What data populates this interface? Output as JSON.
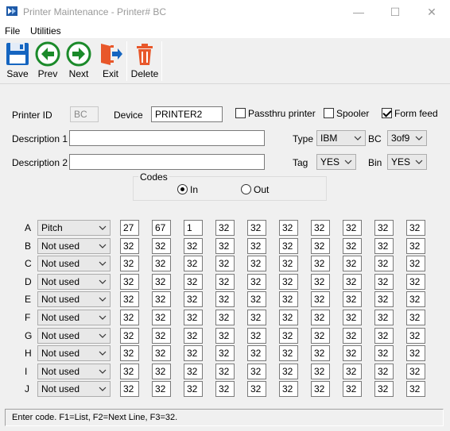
{
  "window": {
    "title": "Printer Maintenance - Printer# BC",
    "minimize": "—",
    "maximize": "☐",
    "close": "✕"
  },
  "menu": [
    "File",
    "Utilities"
  ],
  "toolbar": {
    "save": "Save",
    "prev": "Prev",
    "next": "Next",
    "exit": "Exit",
    "delete": "Delete"
  },
  "form": {
    "printer_id_label": "Printer ID",
    "printer_id_value": "BC",
    "device_label": "Device",
    "device_value": "PRINTER2",
    "passthru_label": "Passthru printer",
    "passthru_checked": false,
    "spooler_label": "Spooler",
    "spooler_checked": false,
    "formfeed_label": "Form feed",
    "formfeed_checked": true,
    "desc1_label": "Description 1",
    "desc1_value": "",
    "desc2_label": "Description 2",
    "desc2_value": "",
    "type_label": "Type",
    "type_value": "IBM",
    "bc_label": "BC",
    "bc_value": "3of9",
    "tag_label": "Tag",
    "tag_value": "YES",
    "bin_label": "Bin",
    "bin_value": "YES"
  },
  "codes": {
    "group_label": "Codes",
    "in_label": "In",
    "out_label": "Out",
    "selected": "In",
    "rows": [
      {
        "letter": "A",
        "option": "Pitch",
        "values": [
          "27",
          "67",
          "1",
          "32",
          "32",
          "32",
          "32",
          "32",
          "32",
          "32"
        ]
      },
      {
        "letter": "B",
        "option": "Not used",
        "values": [
          "32",
          "32",
          "32",
          "32",
          "32",
          "32",
          "32",
          "32",
          "32",
          "32"
        ]
      },
      {
        "letter": "C",
        "option": "Not used",
        "values": [
          "32",
          "32",
          "32",
          "32",
          "32",
          "32",
          "32",
          "32",
          "32",
          "32"
        ]
      },
      {
        "letter": "D",
        "option": "Not used",
        "values": [
          "32",
          "32",
          "32",
          "32",
          "32",
          "32",
          "32",
          "32",
          "32",
          "32"
        ]
      },
      {
        "letter": "E",
        "option": "Not used",
        "values": [
          "32",
          "32",
          "32",
          "32",
          "32",
          "32",
          "32",
          "32",
          "32",
          "32"
        ]
      },
      {
        "letter": "F",
        "option": "Not used",
        "values": [
          "32",
          "32",
          "32",
          "32",
          "32",
          "32",
          "32",
          "32",
          "32",
          "32"
        ]
      },
      {
        "letter": "G",
        "option": "Not used",
        "values": [
          "32",
          "32",
          "32",
          "32",
          "32",
          "32",
          "32",
          "32",
          "32",
          "32"
        ]
      },
      {
        "letter": "H",
        "option": "Not used",
        "values": [
          "32",
          "32",
          "32",
          "32",
          "32",
          "32",
          "32",
          "32",
          "32",
          "32"
        ]
      },
      {
        "letter": "I",
        "option": "Not used",
        "values": [
          "32",
          "32",
          "32",
          "32",
          "32",
          "32",
          "32",
          "32",
          "32",
          "32"
        ]
      },
      {
        "letter": "J",
        "option": "Not used",
        "values": [
          "32",
          "32",
          "32",
          "32",
          "32",
          "32",
          "32",
          "32",
          "32",
          "32"
        ]
      }
    ]
  },
  "status": "Enter code. F1=List, F2=Next Line, F3=32."
}
